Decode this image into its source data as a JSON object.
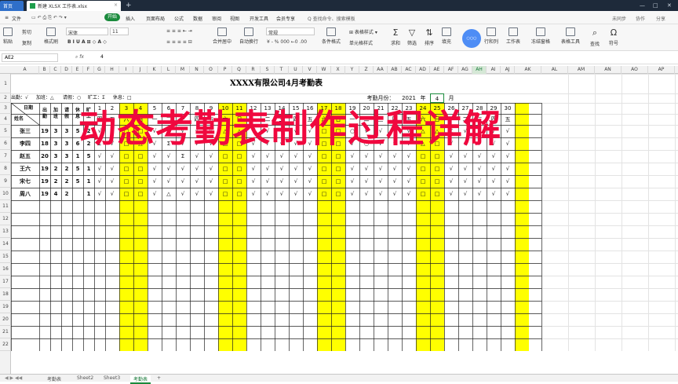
{
  "tabbar": {
    "home": "首页",
    "doc_title": "新建 XLSX 工作表.xlsx",
    "new_tab": "+"
  },
  "menu": {
    "file": "文件",
    "items": [
      "开始",
      "插入",
      "页面布局",
      "公式",
      "数据",
      "审阅",
      "视图",
      "开发工具",
      "会员专享"
    ],
    "search": "Q 查找命令、搜索模板",
    "right": [
      "未同步",
      "协作",
      "分享"
    ]
  },
  "toolbar": {
    "cut": "剪切",
    "copy": "复制",
    "format_painter": "格式刷",
    "paste": "粘贴",
    "font": "宋体",
    "font_size": "11",
    "merge": "合并居中",
    "wrap": "自动换行",
    "number_format": "常规",
    "cond_format": "条件格式",
    "cell_style": "单元格样式",
    "sum": "求和",
    "filter": "筛选",
    "sort": "排序",
    "fill": "填充",
    "cell": "单元格",
    "rowcol": "行和列",
    "worksheet": "工作表",
    "freeze": "冻结窗格",
    "table_tools": "表格工具",
    "find": "查找",
    "symbol": "符号"
  },
  "formula": {
    "cell_ref": "AE2",
    "fx": "fx",
    "value": "4"
  },
  "columns": [
    "A",
    "B",
    "C",
    "D",
    "E",
    "F",
    "G",
    "H",
    "I",
    "J",
    "K",
    "L",
    "M",
    "N",
    "O",
    "P",
    "Q",
    "R",
    "S",
    "T",
    "U",
    "V",
    "W",
    "X",
    "Y",
    "Z",
    "AA",
    "AB",
    "AC",
    "AD",
    "AE",
    "AF",
    "AG",
    "AH",
    "AI",
    "AJ",
    "AK",
    "AL",
    "AM",
    "AN",
    "AO",
    "AP"
  ],
  "rows": [
    "1",
    "2",
    "3",
    "4",
    "5",
    "6",
    "7",
    "8",
    "9",
    "10",
    "11",
    "12",
    "13",
    "14",
    "15",
    "16",
    "17",
    "18",
    "19",
    "20",
    "21",
    "22"
  ],
  "sheet": {
    "title": "XXXX有限公司4月考勤表",
    "legend": [
      "出勤：√",
      "加班：△",
      "请假：○",
      "旷工：Σ",
      "休息：□"
    ],
    "month_label": "考勤月份：",
    "year": "2021",
    "year_unit": "年",
    "month": "4",
    "month_unit": "月",
    "header_date": "日期",
    "header_name": "姓名",
    "header_cols": [
      "出勤",
      "加班",
      "请假",
      "休息",
      "旷工"
    ],
    "days": [
      "1",
      "2",
      "3",
      "4",
      "5",
      "6",
      "7",
      "8",
      "9",
      "10",
      "11",
      "12",
      "13",
      "14",
      "15",
      "16",
      "17",
      "18",
      "19",
      "20",
      "21",
      "22",
      "23",
      "24",
      "25",
      "26",
      "27",
      "28",
      "29",
      "30"
    ],
    "weekdays": [
      "四",
      "五",
      "六",
      "日",
      "一",
      "二",
      "三",
      "四",
      "五",
      "六",
      "日",
      "一",
      "二",
      "三",
      "四",
      "五",
      "六",
      "日",
      "一",
      "二",
      "三",
      "四",
      "五",
      "六",
      "日",
      "一",
      "二",
      "三",
      "四",
      "五"
    ],
    "employees": [
      {
        "name": "张三",
        "stats": [
          "19",
          "3",
          "3",
          "5",
          "2"
        ],
        "marks": [
          "√",
          "√",
          "□",
          "□",
          "√",
          "√",
          "√",
          "√",
          "√",
          "△",
          "△",
          "√",
          "√",
          "√",
          "√",
          "√",
          "□",
          "□",
          "○",
          "√",
          "√",
          "√",
          "√",
          "△",
          "△",
          "Σ",
          "√",
          "√",
          "√",
          "√"
        ]
      },
      {
        "name": "李四",
        "stats": [
          "18",
          "3",
          "3",
          "6",
          "2"
        ],
        "marks": [
          "Σ",
          "√",
          "□",
          "△",
          "√",
          "Σ",
          "√",
          "√",
          "√",
          "□",
          "□",
          "√",
          "√",
          "√",
          "√",
          "√",
          "□",
          "□",
          "√",
          "○",
          "√",
          "√",
          "√",
          "△",
          "□",
          "√",
          "√",
          "√",
          "√",
          "√"
        ]
      },
      {
        "name": "赵五",
        "stats": [
          "20",
          "3",
          "3",
          "1",
          "5"
        ],
        "marks": [
          "√",
          "√",
          "□",
          "□",
          "√",
          "√",
          "Σ",
          "√",
          "√",
          "□",
          "□",
          "√",
          "√",
          "√",
          "√",
          "√",
          "□",
          "□",
          "√",
          "√",
          "√",
          "√",
          "√",
          "□",
          "□",
          "√",
          "√",
          "√",
          "√",
          "√"
        ]
      },
      {
        "name": "王六",
        "stats": [
          "19",
          "2",
          "2",
          "5",
          "1"
        ],
        "marks": [
          "√",
          "√",
          "□",
          "□",
          "√",
          "√",
          "√",
          "√",
          "√",
          "□",
          "□",
          "√",
          "√",
          "√",
          "√",
          "√",
          "□",
          "□",
          "√",
          "√",
          "√",
          "√",
          "√",
          "□",
          "□",
          "√",
          "√",
          "√",
          "√",
          "√"
        ]
      },
      {
        "name": "宋七",
        "stats": [
          "19",
          "2",
          "2",
          "5",
          "1"
        ],
        "marks": [
          "√",
          "√",
          "□",
          "□",
          "√",
          "√",
          "√",
          "√",
          "√",
          "□",
          "□",
          "√",
          "√",
          "√",
          "√",
          "√",
          "□",
          "□",
          "√",
          "√",
          "√",
          "√",
          "√",
          "□",
          "□",
          "√",
          "√",
          "√",
          "√",
          "√"
        ]
      },
      {
        "name": "周八",
        "stats": [
          "19",
          "4",
          "2",
          "",
          "1"
        ],
        "marks": [
          "√",
          "√",
          "□",
          "□",
          "√",
          "△",
          "√",
          "√",
          "√",
          "□",
          "□",
          "√",
          "√",
          "√",
          "√",
          "√",
          "□",
          "□",
          "√",
          "√",
          "√",
          "√",
          "√",
          "□",
          "□",
          "√",
          "√",
          "√",
          "√",
          "√"
        ]
      }
    ]
  },
  "overlay": "动态考勤表制作过程详解",
  "sheet_tabs": [
    "考勤表",
    "Sheet2",
    "Sheet3",
    "考勤表"
  ],
  "colors": {
    "highlight": "#ffff00",
    "overlay_text": "#f0083e",
    "accent": "#1a8a3c"
  }
}
